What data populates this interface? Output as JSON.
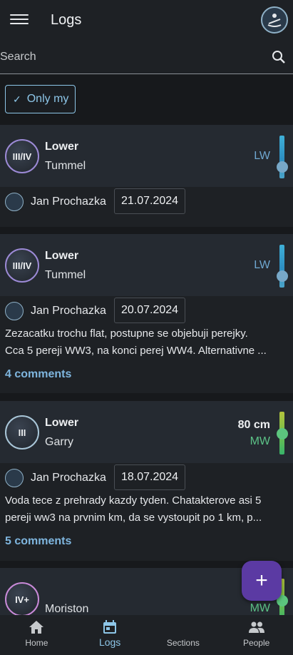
{
  "appbar": {
    "title": "Logs"
  },
  "search": {
    "placeholder": "Search"
  },
  "filter": {
    "only_my_label": "Only my"
  },
  "cards": [
    {
      "grade": "III/IV",
      "name": "Lower",
      "river": "Tummel",
      "level": "LW",
      "flow": "",
      "author": "Jan Prochazka",
      "date": "21.07.2024",
      "text_lines": [],
      "comments": ""
    },
    {
      "grade": "III/IV",
      "name": "Lower",
      "river": "Tummel",
      "level": "LW",
      "flow": "",
      "author": "Jan Prochazka",
      "date": "20.07.2024",
      "text_lines": [
        "Zezacatku trochu flat, postupne se objebuji perejky.",
        "Cca 5 pereji WW3, na konci perej WW4. Alternativne ..."
      ],
      "comments": "4 comments"
    },
    {
      "grade": "III",
      "name": "Lower",
      "river": "Garry",
      "level": "MW",
      "flow": "80 cm",
      "author": "Jan Prochazka",
      "date": "18.07.2024",
      "text_lines": [
        "Voda tece z prehrady kazdy tyden. Chatakterove asi 5",
        "pereji ww3 na prvnim km, da se vystoupit po 1 km, p..."
      ],
      "comments": "5 comments"
    },
    {
      "grade": "IV+",
      "name": "",
      "river": "Moriston",
      "level": "MW",
      "flow": "8",
      "author": "",
      "date": "",
      "text_lines": [],
      "comments": ""
    }
  ],
  "fab": {
    "label": "+"
  },
  "nav": {
    "home": "Home",
    "logs": "Logs",
    "sections": "Sections",
    "people": "People"
  },
  "colors": {
    "accent": "#8dc6e8",
    "fab": "#5b3aa3",
    "low_water": "#6fa7d0",
    "medium_water": "#5cc287"
  }
}
